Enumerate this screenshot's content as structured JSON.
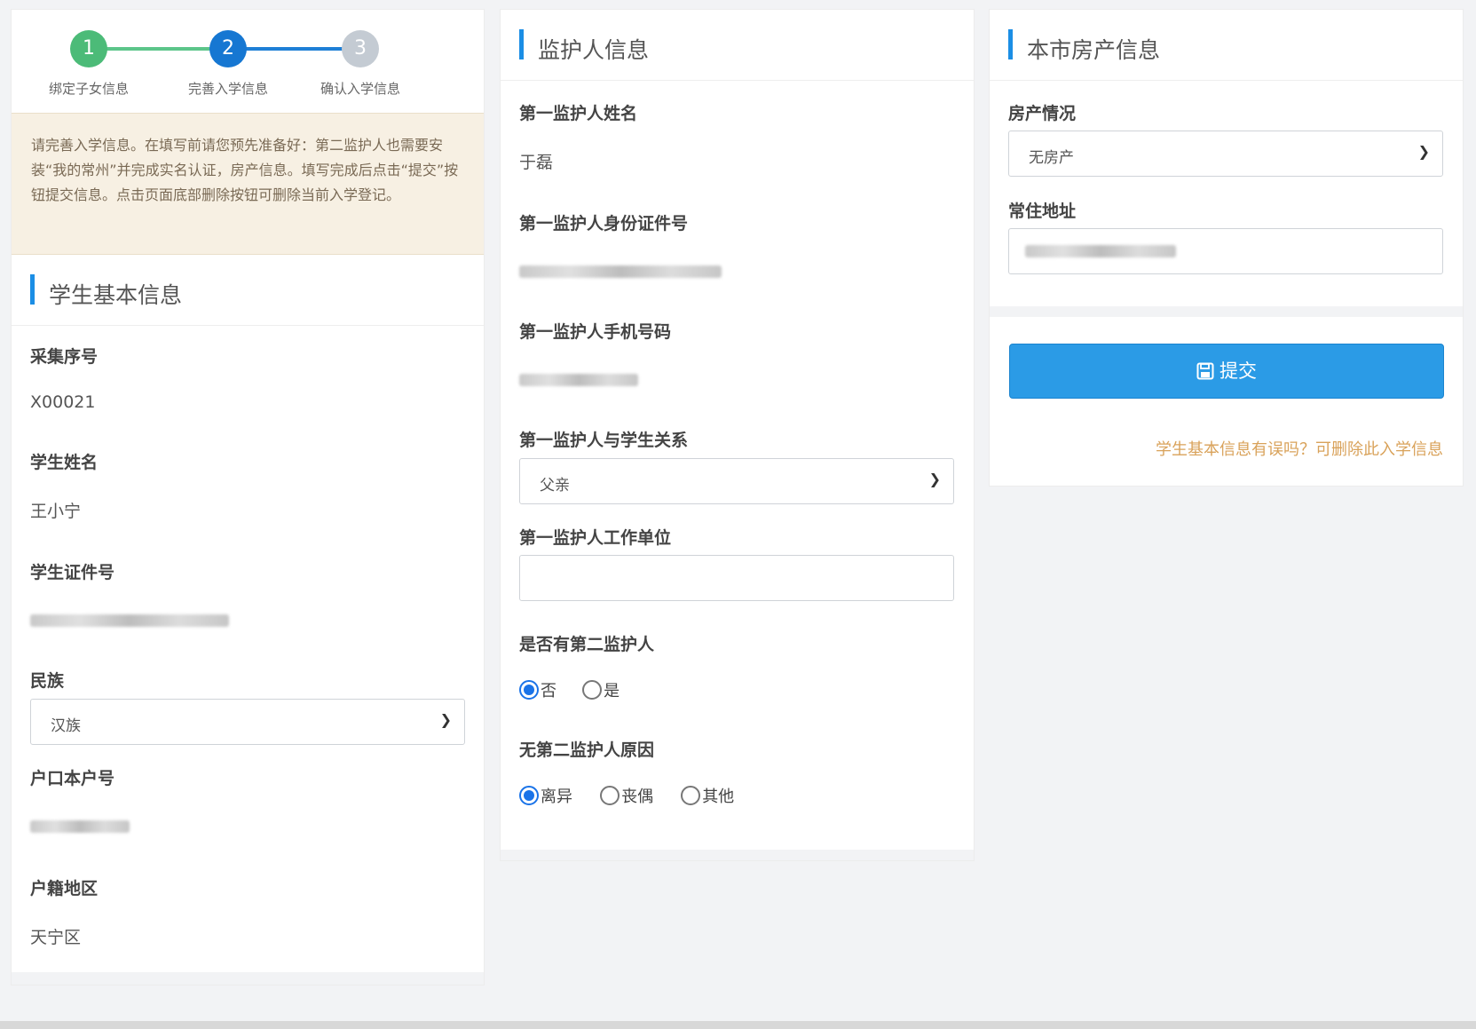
{
  "stepper": {
    "steps": [
      {
        "number": "1",
        "label": "绑定子女信息",
        "status": "done"
      },
      {
        "number": "2",
        "label": "完善入学信息",
        "status": "current"
      },
      {
        "number": "3",
        "label": "确认入学信息",
        "status": "pending"
      }
    ]
  },
  "notice": "请完善入学信息。在填写前请您预先准备好：第二监护人也需要安装“我的常州”并完成实名认证，房产信息。填写完成后点击“提交”按钮提交信息。点击页面底部删除按钮可删除当前入学登记。",
  "student": {
    "section_title": "学生基本信息",
    "collect_no_label": "采集序号",
    "collect_no": "X00021",
    "name_label": "学生姓名",
    "name": "王小宁",
    "id_label": "学生证件号",
    "ethnicity_label": "民族",
    "ethnicity": "汉族",
    "hukou_no_label": "户口本户号",
    "hukou_area_label": "户籍地区",
    "hukou_area": "天宁区"
  },
  "guardian": {
    "section_title": "监护人信息",
    "name_label": "第一监护人姓名",
    "name": "于磊",
    "id_label": "第一监护人身份证件号",
    "phone_label": "第一监护人手机号码",
    "relation_label": "第一监护人与学生关系",
    "relation": "父亲",
    "work_label": "第一监护人工作单位",
    "work": "",
    "second_label": "是否有第二监护人",
    "second_options": [
      {
        "label": "否",
        "checked": true
      },
      {
        "label": "是",
        "checked": false
      }
    ],
    "no_second_reason_label": "无第二监护人原因",
    "reason_options": [
      {
        "label": "离异",
        "checked": true
      },
      {
        "label": "丧偶",
        "checked": false
      },
      {
        "label": "其他",
        "checked": false
      }
    ]
  },
  "property": {
    "section_title": "本市房产信息",
    "status_label": "房产情况",
    "status": "无房产",
    "address_label": "常住地址"
  },
  "actions": {
    "submit_label": "提交",
    "delete_link": "学生基本信息有误吗？可删除此入学信息"
  },
  "colors": {
    "accent": "#1b8ee5",
    "step_done": "#4cbb78",
    "step_current": "#1677d2",
    "step_pending": "#c4cbd3",
    "submit": "#2b9be6",
    "link": "#d9a25a",
    "notice_bg": "#f7f0e3"
  },
  "icons": {
    "submit": "floppy-disk-icon",
    "select": "chevron-down-icon"
  }
}
